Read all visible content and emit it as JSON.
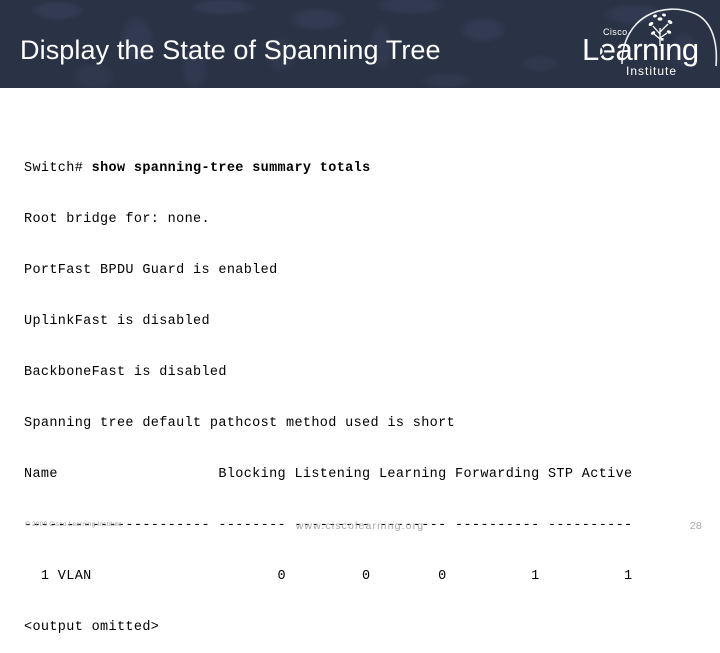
{
  "slide": {
    "title": "Display the State of Spanning Tree",
    "header_bg": "#2a3246",
    "title_color": "#ffffff"
  },
  "logo": {
    "brand_small": "Cisco",
    "brand_main": "Learning",
    "brand_sub": "Institute"
  },
  "terminal": {
    "prompt": "Switch# ",
    "command": "show spanning-tree summary totals",
    "lines": [
      "Root bridge for: none.",
      "PortFast BPDU Guard is enabled",
      "UplinkFast is disabled",
      "BackboneFast is disabled",
      "Spanning tree default pathcost method used is short",
      "Name                   Blocking Listening Learning Forwarding STP Active",
      "---------------------- -------- --------- -------- ---------- ----------",
      "  1 VLAN                      0         0        0          1          1",
      "<output omitted>"
    ],
    "table": {
      "columns": [
        "Name",
        "Blocking",
        "Listening",
        "Learning",
        "Forwarding",
        "STP Active"
      ],
      "rows": [
        [
          "1 VLAN",
          "0",
          "0",
          "0",
          "1",
          "1"
        ]
      ],
      "truncation_note": "<output omitted>"
    }
  },
  "footer": {
    "copyright": "© 2009 Cisco Learning Institute",
    "url": "www.ciscolearning.org",
    "page_number": "28"
  }
}
